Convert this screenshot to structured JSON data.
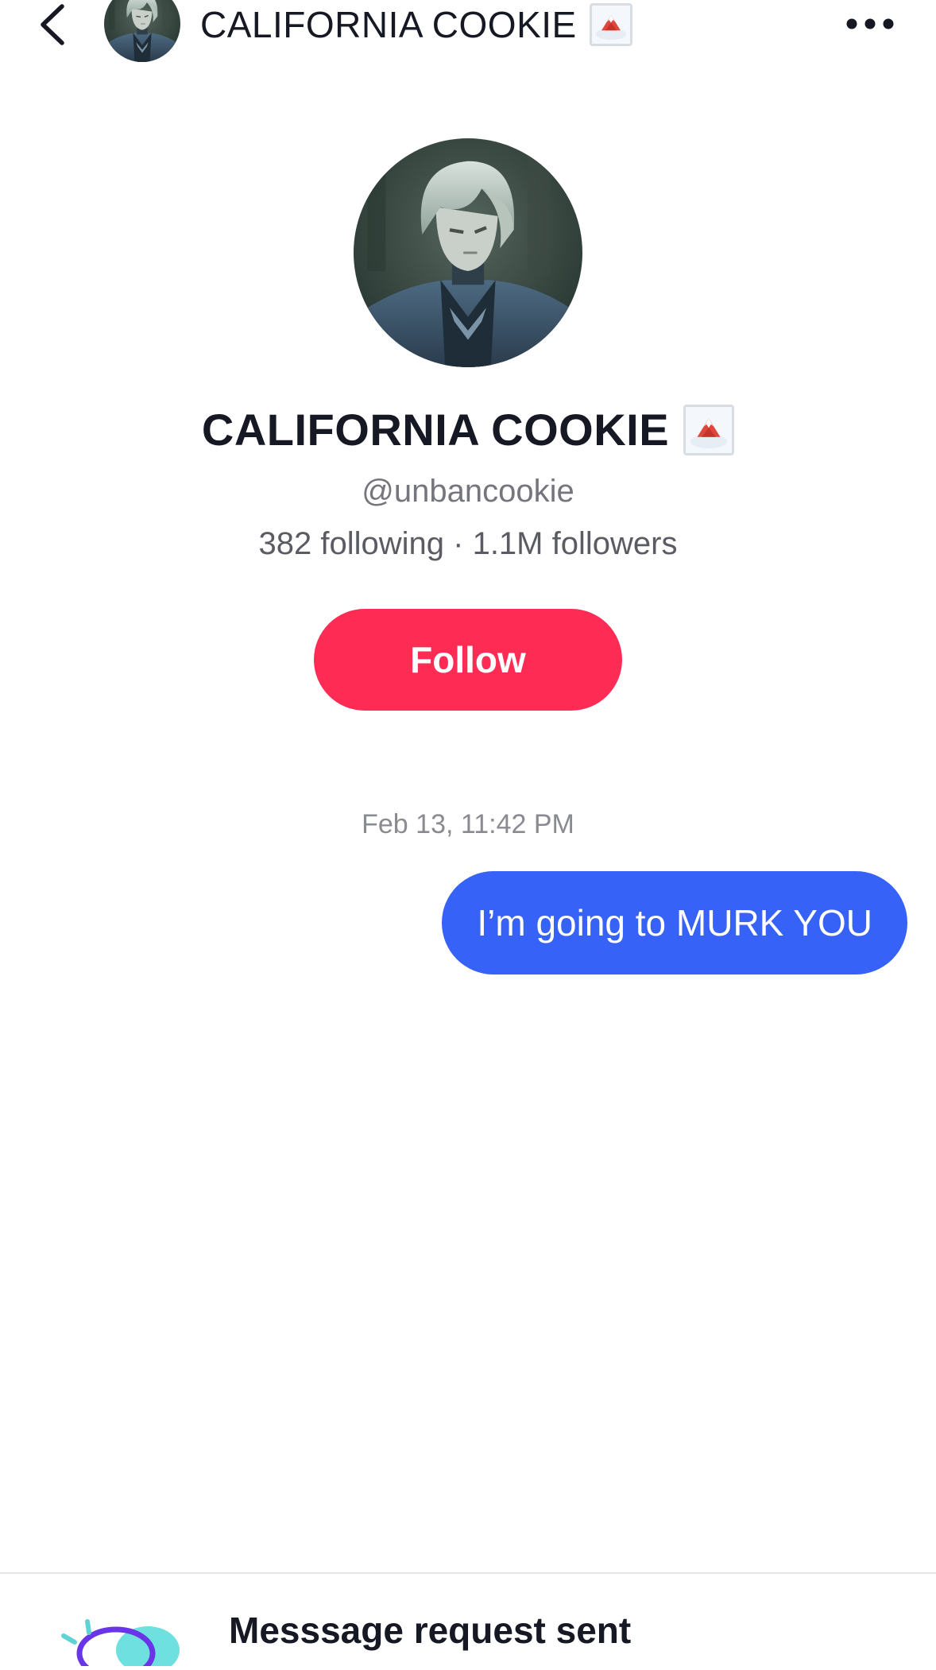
{
  "header": {
    "title": "CALIFORNIA COOKIE",
    "back_icon": "chevron-left-icon",
    "more_icon": "more-horizontal-icon"
  },
  "profile": {
    "name": "CALIFORNIA COOKIE",
    "handle": "@unbancookie",
    "stats": "382 following · 1.1M followers",
    "follow_label": "Follow"
  },
  "conversation": {
    "timestamp": "Feb 13, 11:42 PM",
    "messages": [
      {
        "direction": "sent",
        "text": "I’m going to MURK YOU"
      }
    ]
  },
  "notice": {
    "title": "Messsage request sent"
  },
  "colors": {
    "follow_button": "#fe2c55",
    "sent_bubble": "#3662f7",
    "text_primary": "#161823",
    "text_secondary": "#75767d"
  }
}
